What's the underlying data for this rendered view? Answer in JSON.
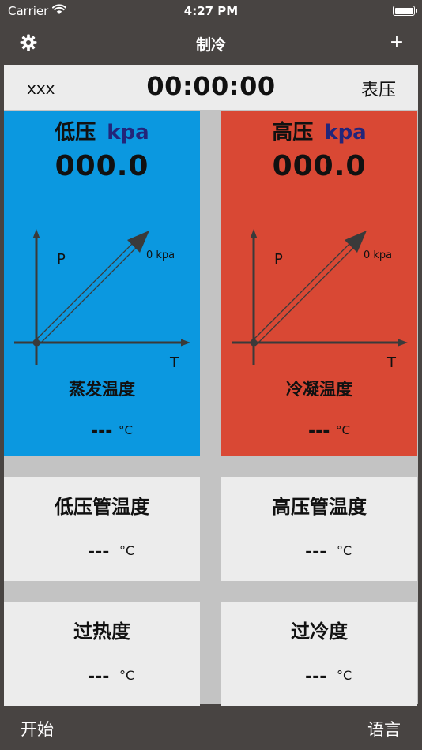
{
  "status_bar": {
    "carrier": "Carrier",
    "time": "4:27 PM"
  },
  "nav": {
    "title": "制冷",
    "add_label": "+"
  },
  "info_row": {
    "left_label": "xxx",
    "timer": "00:00:00",
    "right_label": "表压"
  },
  "low_pressure": {
    "title": "低压",
    "unit": "kpa",
    "value": "000.0",
    "axis_p": "P",
    "axis_t": "T",
    "gauge_value": "0 kpa",
    "sat_label": "蒸发温度",
    "sat_value": "---",
    "sat_unit": "°C",
    "color": "#0b98e0"
  },
  "high_pressure": {
    "title": "高压",
    "unit": "kpa",
    "value": "000.0",
    "axis_p": "P",
    "axis_t": "T",
    "gauge_value": "0 kpa",
    "sat_label": "冷凝温度",
    "sat_value": "---",
    "sat_unit": "°C",
    "color": "#d94834"
  },
  "cards": {
    "low_pipe": {
      "label": "低压管温度",
      "value": "---",
      "unit": "°C"
    },
    "high_pipe": {
      "label": "高压管温度",
      "value": "---",
      "unit": "°C"
    },
    "superheat": {
      "label": "过热度",
      "value": "---",
      "unit": "°C"
    },
    "subcool": {
      "label": "过冷度",
      "value": "---",
      "unit": "°C"
    }
  },
  "bottom_bar": {
    "start_label": "开始",
    "language_label": "语言"
  },
  "colors": {
    "background": "#484442",
    "card": "#ececec",
    "divider": "#c3c3c3",
    "unit_text": "#23257a"
  }
}
